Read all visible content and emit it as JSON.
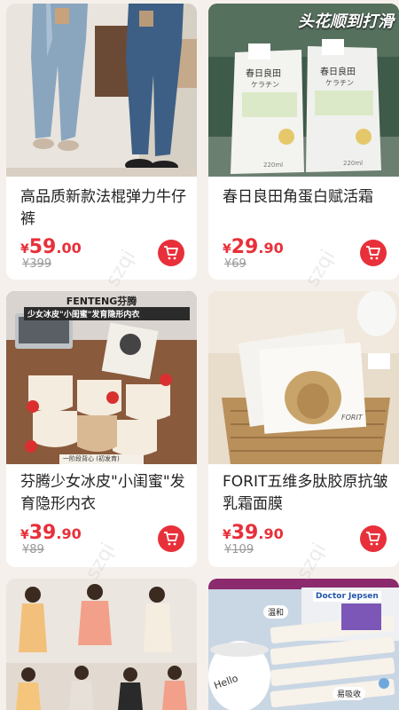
{
  "products": [
    {
      "title": "高品质新款法棍弹力牛仔裤",
      "price_int": "59",
      "price_dec": ".00",
      "old_price": "399",
      "currency": "¥"
    },
    {
      "title": "春日良田角蛋白赋活霜",
      "price_int": "29",
      "price_dec": ".90",
      "old_price": "69",
      "currency": "¥",
      "banner": "头花顺到打滑",
      "pack_brand": "春日良田",
      "pack_text": "ケラチン",
      "pack_volume": "220ml"
    },
    {
      "title": "芬腾少女冰皮\"小闺蜜\"发育隐形内衣",
      "price_int": "39",
      "price_dec": ".90",
      "old_price": "89",
      "currency": "¥",
      "img_brand": "FENTENG芬腾",
      "img_headline": "少女冰皮\"小闺蜜\"发育隐形内衣",
      "img_footer": "一阶段背心 (初发育)"
    },
    {
      "title": "FORIT五维多肽胶原抗皱乳霜面膜",
      "price_int": "39",
      "price_dec": ".90",
      "old_price": "109",
      "currency": "¥",
      "img_brand": "FORIT"
    },
    {
      "title": "",
      "img_tag_1": "",
      "img_tag_2": ""
    },
    {
      "title": "",
      "img_brand": "Doctor Jepsen",
      "img_tag_1": "温和",
      "img_tag_2": "易吸收",
      "img_cup": "Hello"
    }
  ],
  "watermark": "szqi",
  "colors": {
    "accent": "#e8303a",
    "background": "#f5f0eb"
  }
}
